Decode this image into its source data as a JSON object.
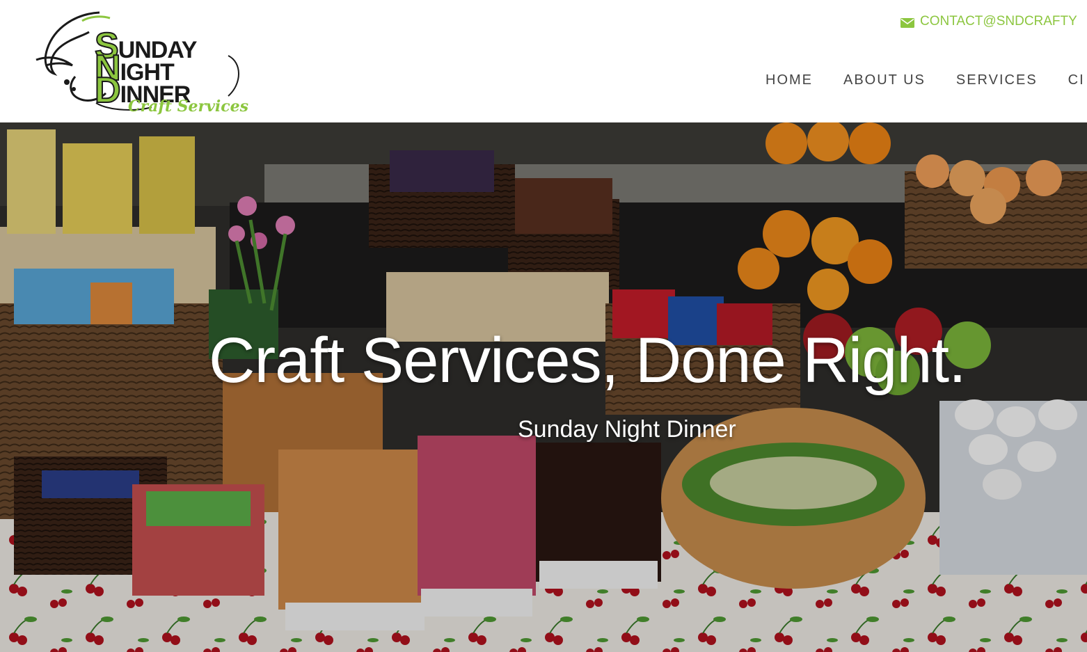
{
  "logo": {
    "line1": "UNDAY",
    "line1_initial": "S",
    "line2": "IGHT",
    "line2_initial": "N",
    "line3": "INNER",
    "line3_initial": "D",
    "tagline": "Craft Services"
  },
  "contact": {
    "icon": "envelope-icon",
    "email": "CONTACT@SNDCRAFTY"
  },
  "nav": {
    "items": [
      {
        "label": "HOME"
      },
      {
        "label": "ABOUT US"
      },
      {
        "label": "SERVICES"
      },
      {
        "label": "CI"
      }
    ]
  },
  "hero": {
    "title": "Craft Services, Done Right.",
    "subtitle": "Sunday Night Dinner"
  },
  "colors": {
    "brand_green": "#8cc63f",
    "nav_text": "#444444",
    "hero_text": "#ffffff"
  }
}
